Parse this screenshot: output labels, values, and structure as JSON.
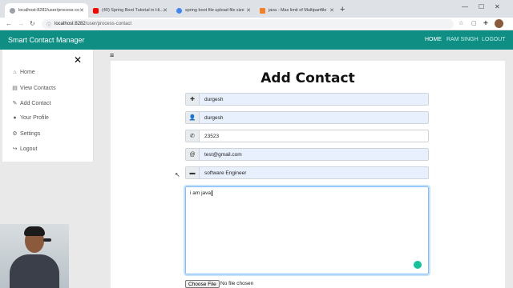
{
  "browser": {
    "tabs": [
      {
        "title": "localhost:8282/user/process-co",
        "color": "#9aa0a6"
      },
      {
        "title": "(40) Spring Boot Tutorial in Hindi",
        "color": "#ff0000"
      },
      {
        "title": "spring boot file upload file size",
        "color": "#4285f4"
      },
      {
        "title": "java - Max limit of Multipartfile",
        "color": "#f48024"
      }
    ],
    "url_host": "localhost:8282",
    "url_path": "/user/process-contact"
  },
  "navbar": {
    "brand": "Smart Contact Manager",
    "links": [
      "HOME",
      "RAM SINGH",
      "LOGOUT"
    ]
  },
  "sidebar": {
    "items": [
      {
        "label": "Home",
        "icon": "home-icon"
      },
      {
        "label": "View Contacts",
        "icon": "address-book-icon"
      },
      {
        "label": "Add Contact",
        "icon": "pencil-icon"
      },
      {
        "label": "Your Profile",
        "icon": "user-circle-icon"
      },
      {
        "label": "Settings",
        "icon": "cogs-icon"
      },
      {
        "label": "Logout",
        "icon": "sign-out-icon"
      }
    ]
  },
  "form": {
    "title": "Add Contact",
    "fields": [
      {
        "value": "durgesh",
        "icon": "plus-icon"
      },
      {
        "value": "durgesh",
        "icon": "user-icon"
      },
      {
        "value": "23523",
        "icon": "phone-icon"
      },
      {
        "value": "test@gmail.com",
        "icon": "at-icon"
      },
      {
        "value": "software Engineer",
        "icon": "briefcase-icon"
      }
    ],
    "description": "i am java",
    "file_button": "Choose File",
    "file_status": "No file chosen"
  }
}
